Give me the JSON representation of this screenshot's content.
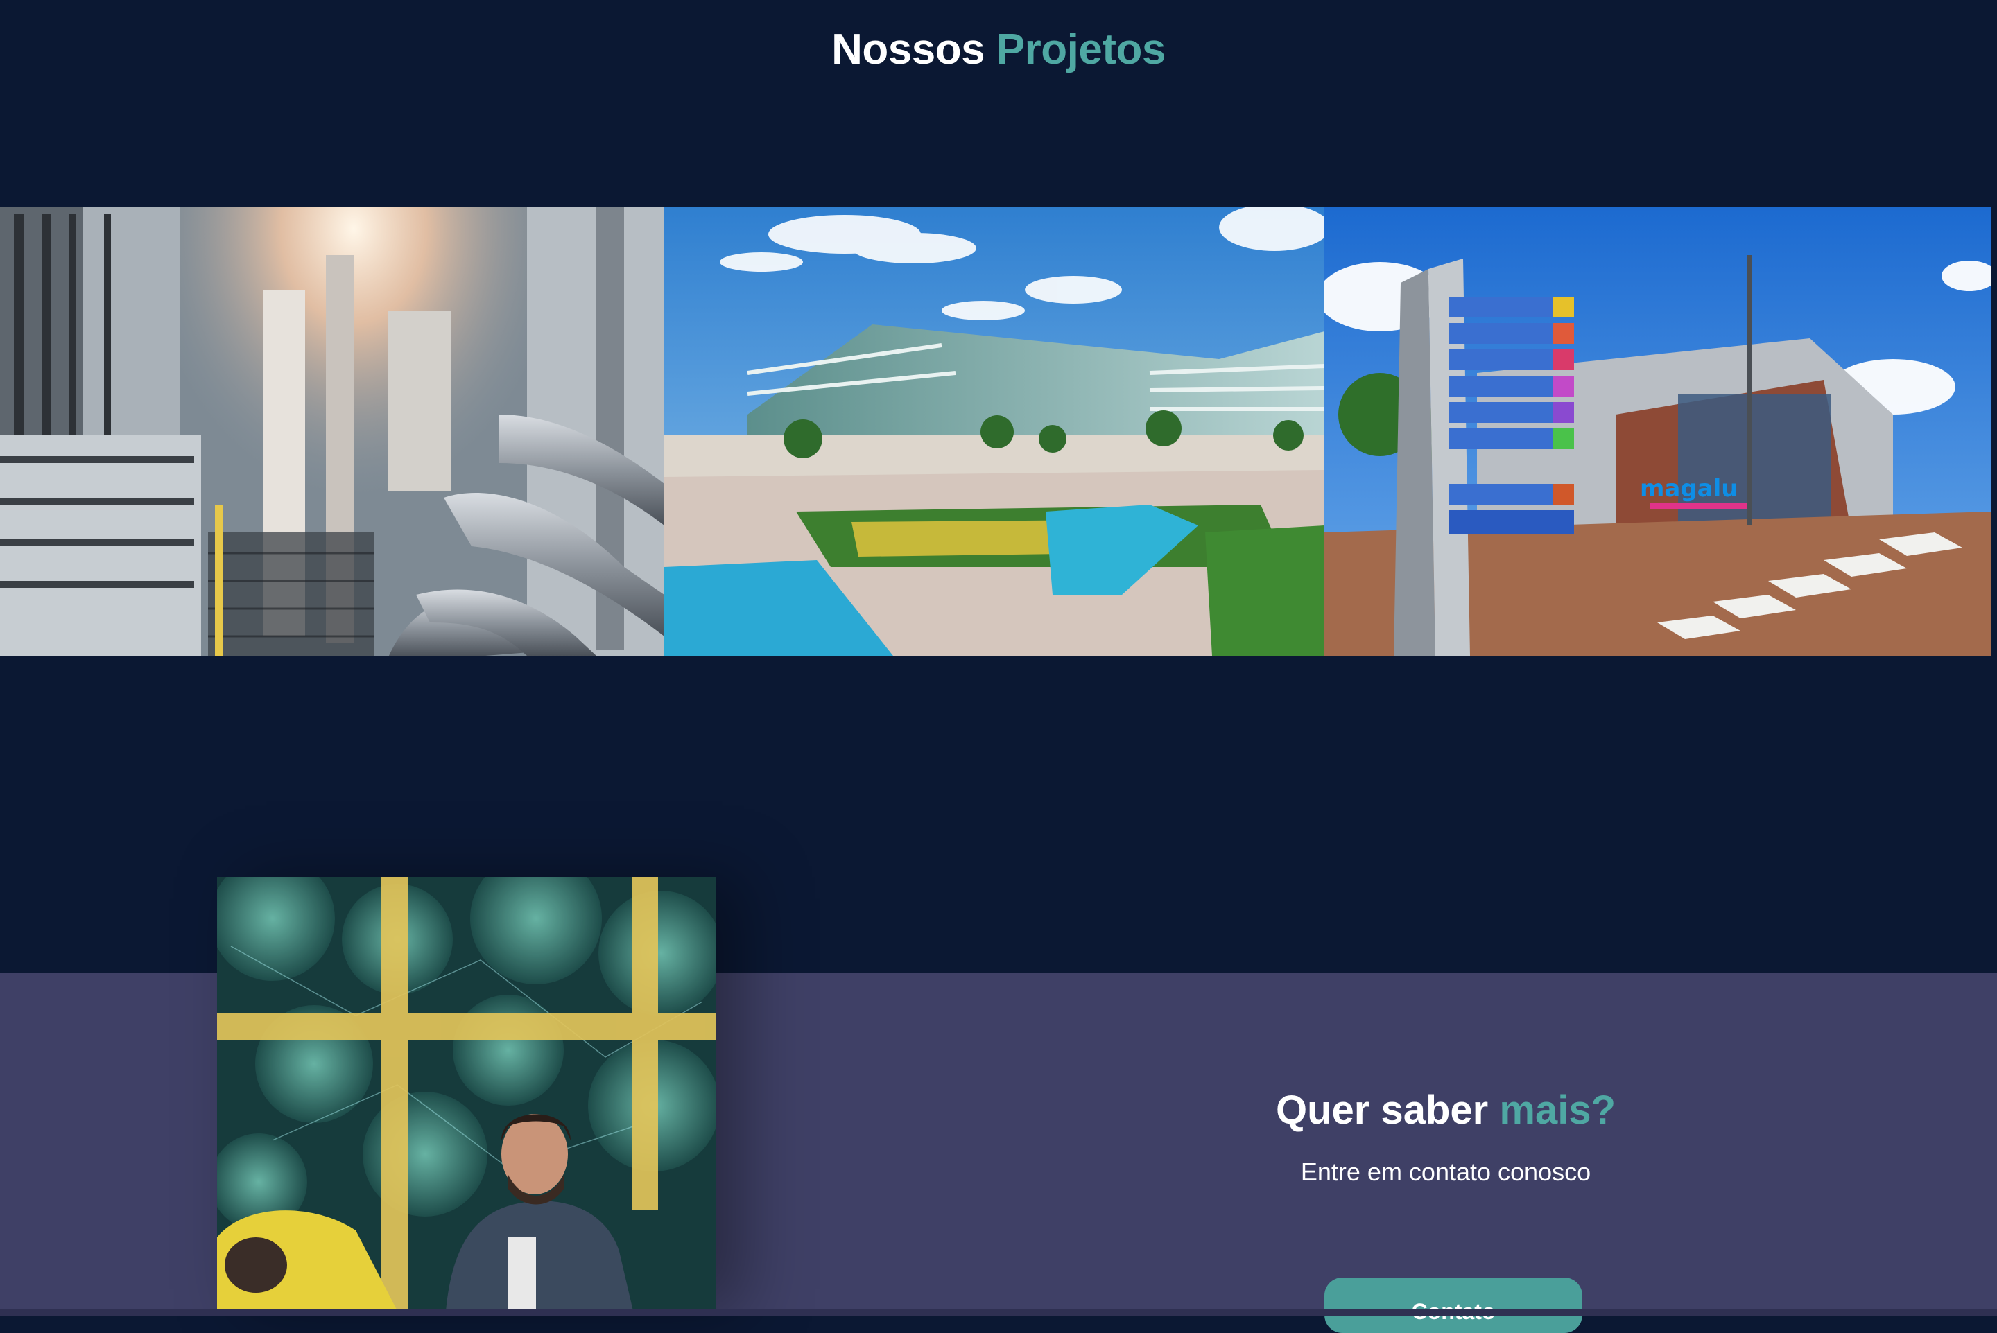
{
  "projects": {
    "title_word": "Nossos",
    "title_accent": "Projetos",
    "images": [
      {
        "name": "industrial-hvac-ducts-photo"
      },
      {
        "name": "corporate-campus-pool-photo"
      },
      {
        "name": "magalu-building-signpost-photo",
        "sign_logo_text": "magalu"
      }
    ]
  },
  "contact": {
    "title_word": "Quer saber",
    "title_accent": "mais?",
    "subtitle": "Entre em contato conosco",
    "button_label": "Contato"
  },
  "colors": {
    "background_dark": "#0b1833",
    "background_contact": "#3f4066",
    "accent": "#4fa8a3",
    "button": "#4a9f9a",
    "text": "#ffffff"
  }
}
